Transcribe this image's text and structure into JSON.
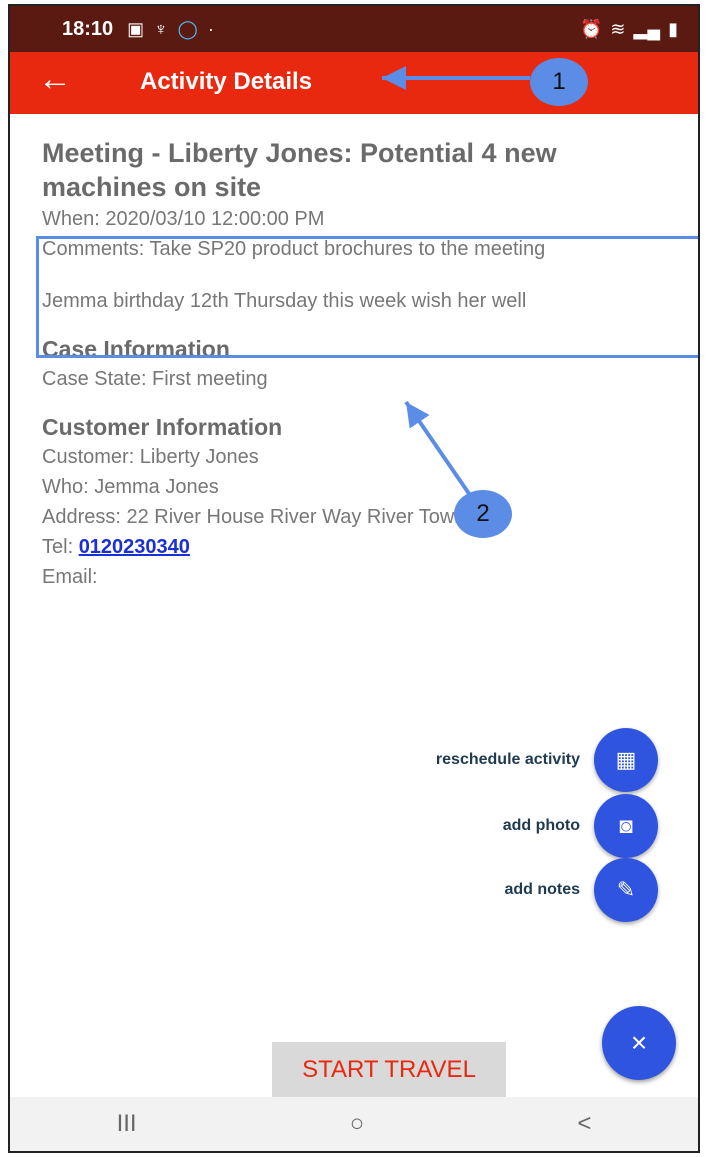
{
  "status_bar": {
    "time": "18:10",
    "left_icons": [
      "gallery-icon",
      "usb-icon",
      "circle-icon",
      "dot-icon"
    ],
    "right_icons": [
      "alarm-icon",
      "wifi-icon",
      "signal-icon",
      "battery-icon"
    ]
  },
  "app_bar": {
    "back_icon": "←",
    "title": "Activity Details"
  },
  "activity": {
    "title": "Meeting - Liberty Jones: Potential 4 new machines on site",
    "when": "When: 2020/03/10 12:00:00 PM",
    "comments_line1": "Comments: Take SP20 product brochures to the meeting",
    "comments_line2": "Jemma birthday 12th Thursday this week wish her well"
  },
  "case": {
    "heading": "Case Information",
    "state": "Case State: First meeting"
  },
  "customer": {
    "heading": "Customer Information",
    "customer": "Customer: Liberty Jones",
    "who": "Who: Jemma Jones",
    "address": "Address: 22 River House River Way River Town Ri...",
    "tel_label": "Tel:",
    "tel_value": "0120230340",
    "email": "Email:"
  },
  "fab_menu": {
    "reschedule_label": "reschedule activity",
    "photo_label": "add photo",
    "notes_label": "add notes",
    "close_icon": "×"
  },
  "buttons": {
    "start_travel": "START TRAVEL"
  },
  "nav_bar": {
    "recents": "III",
    "home": "○",
    "back": "<"
  },
  "annotations": {
    "badge1": "1",
    "badge2": "2"
  },
  "colors": {
    "app_bar": "#e8290f",
    "status_bar": "#5a1a12",
    "fab": "#2f55e0",
    "annotation": "#5b8de6"
  }
}
